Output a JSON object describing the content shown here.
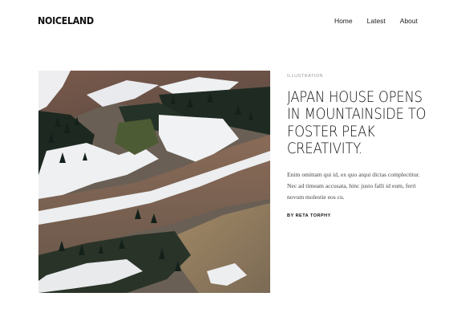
{
  "site": {
    "logo": "NOICELAND"
  },
  "nav": {
    "items": [
      {
        "label": "Home"
      },
      {
        "label": "Latest"
      },
      {
        "label": "About"
      }
    ]
  },
  "hero": {
    "image_icon": "mountain-landscape-photo"
  },
  "article": {
    "category": "Illustration",
    "title_lines": [
      "JAPAN HOUSE OPENS",
      "IN MOUNTAINSIDE TO",
      "FOSTER PEAK",
      "CREATIVITY."
    ],
    "excerpt_lines": [
      "Enim omittam qui id, ex quo atqui dictas complectitur.",
      "Nec ad timeam accusata, hinc justo falli id eum, ferri",
      "novum molestie eos cu."
    ],
    "author": "By Reta Torphy"
  },
  "colors": {
    "background": "#ffffff",
    "text": "#111111",
    "muted": "#9a9a9a"
  }
}
